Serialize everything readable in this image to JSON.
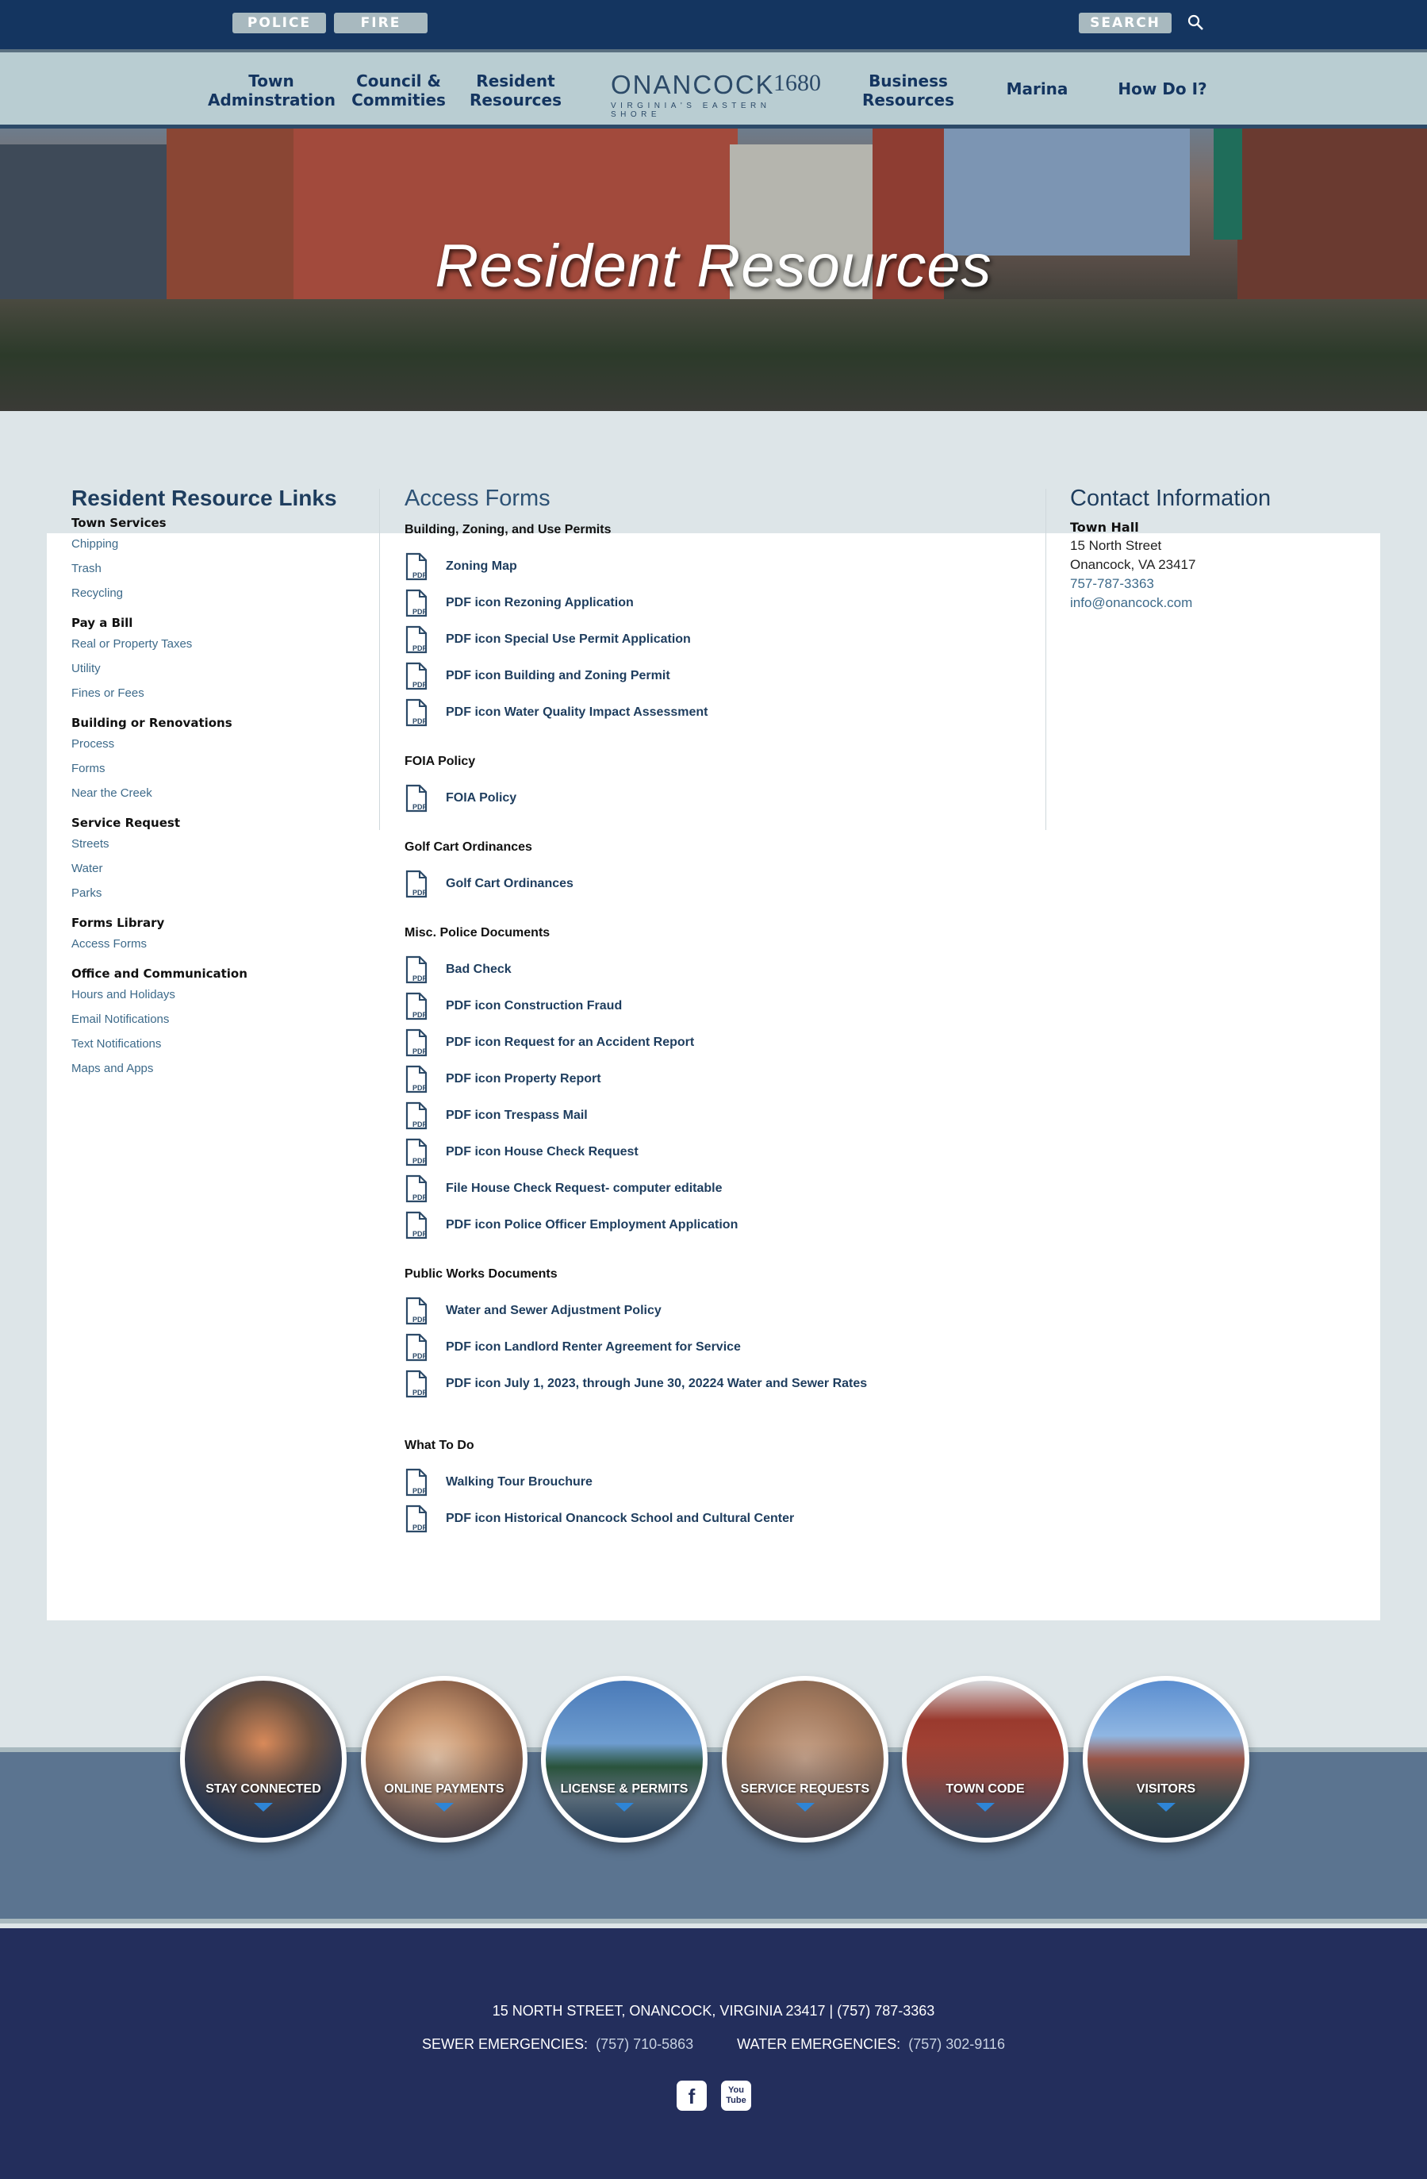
{
  "utility": {
    "police": "POLICE",
    "fire": "FIRE",
    "search": "SEARCH"
  },
  "nav": {
    "town": "Town\nAdminstration",
    "council": "Council &\nCommities",
    "resident": "Resident\nResources",
    "business": "Business\nResources",
    "marina": "Marina",
    "how": "How Do I?"
  },
  "logo": {
    "name": "ONANCOCK",
    "year": "1680",
    "tagline": "VIRGINIA'S EASTERN SHORE"
  },
  "hero": {
    "title": "Resident Resources"
  },
  "sidebar": {
    "title": "Resident Resource Links",
    "groups": [
      {
        "heading": "Town Services",
        "links": [
          "Chipping",
          "Trash",
          "Recycling"
        ]
      },
      {
        "heading": "Pay a Bill",
        "links": [
          "Real or Property Taxes",
          "Utility",
          "Fines or Fees"
        ]
      },
      {
        "heading": "Building or Renovations",
        "links": [
          "Process",
          "Forms",
          "Near the Creek"
        ]
      },
      {
        "heading": "Service Request",
        "links": [
          "Streets",
          "Water",
          "Parks"
        ]
      },
      {
        "heading": "Forms Library",
        "links": [
          "Access Forms"
        ]
      },
      {
        "heading": "Office and Communication",
        "links": [
          "Hours and Holidays",
          "Email Notifications",
          "Text Notifications",
          "Maps and Apps"
        ]
      }
    ]
  },
  "forms": {
    "title": "Access Forms",
    "pdf_icon_text": "PDF",
    "sections": [
      {
        "heading": "Building, Zoning, and Use Permits",
        "docs": [
          "Zoning Map",
          "PDF icon Rezoning Application",
          "PDF icon Special Use Permit Application",
          "PDF icon Building and Zoning Permit",
          "PDF icon Water Quality Impact Assessment"
        ]
      },
      {
        "heading": "FOIA Policy",
        "docs": [
          "FOIA Policy"
        ]
      },
      {
        "heading": "Golf Cart Ordinances",
        "docs": [
          "Golf Cart Ordinances"
        ]
      },
      {
        "heading": "Misc. Police Documents",
        "docs": [
          "Bad Check",
          "PDF icon Construction Fraud",
          "PDF icon Request for an Accident Report",
          "PDF icon Property Report",
          "PDF icon Trespass Mail",
          "PDF icon House Check Request",
          "File House Check Request- computer editable",
          "PDF icon Police Officer Employment Application"
        ]
      },
      {
        "heading": "Public Works Documents",
        "docs": [
          "Water and Sewer Adjustment Policy",
          "PDF icon Landlord Renter Agreement for Service",
          "PDF icon July 1, 2023, through June 30, 20224 Water and Sewer Rates"
        ]
      },
      {
        "heading": "What To Do",
        "docs": [
          "Walking Tour Brouchure",
          "PDF icon Historical Onancock School and Cultural Center"
        ]
      }
    ]
  },
  "contact": {
    "title": "Contact Information",
    "heading": "Town Hall",
    "street": "15 North Street",
    "city": "Onancock, VA 23417",
    "phone": "757-787-3363",
    "email": "info@onancock.com"
  },
  "quicklinks": [
    {
      "label": "STAY CONNECTED",
      "icon": "phone-app-photo"
    },
    {
      "label": "ONLINE PAYMENTS",
      "icon": "laptop-photo"
    },
    {
      "label": "LICENSE & PERMITS",
      "icon": "harbor-photo"
    },
    {
      "label": "SERVICE REQUESTS",
      "icon": "smartphone-photo"
    },
    {
      "label": "TOWN CODE",
      "icon": "town-hall-photo"
    },
    {
      "label": "VISITORS",
      "icon": "street-crowd-photo"
    }
  ],
  "footer": {
    "address": "15 NORTH STREET, ONANCOCK, VIRGINIA 23417   |   (757) 787-3363",
    "sewer_label": "SEWER EMERGENCIES:",
    "sewer_phone": "(757) 710-5863",
    "water_label": "WATER EMERGENCIES:",
    "water_phone": "(757) 302-9116",
    "facebook": "f",
    "youtube_top": "You",
    "youtube_bottom": "Tube"
  },
  "colors": {
    "navy": "#143560",
    "nav_bg": "#b9cdd2",
    "link": "#3d6a8a",
    "footer": "#232e5c",
    "accent_arrow": "#2e85d6"
  }
}
